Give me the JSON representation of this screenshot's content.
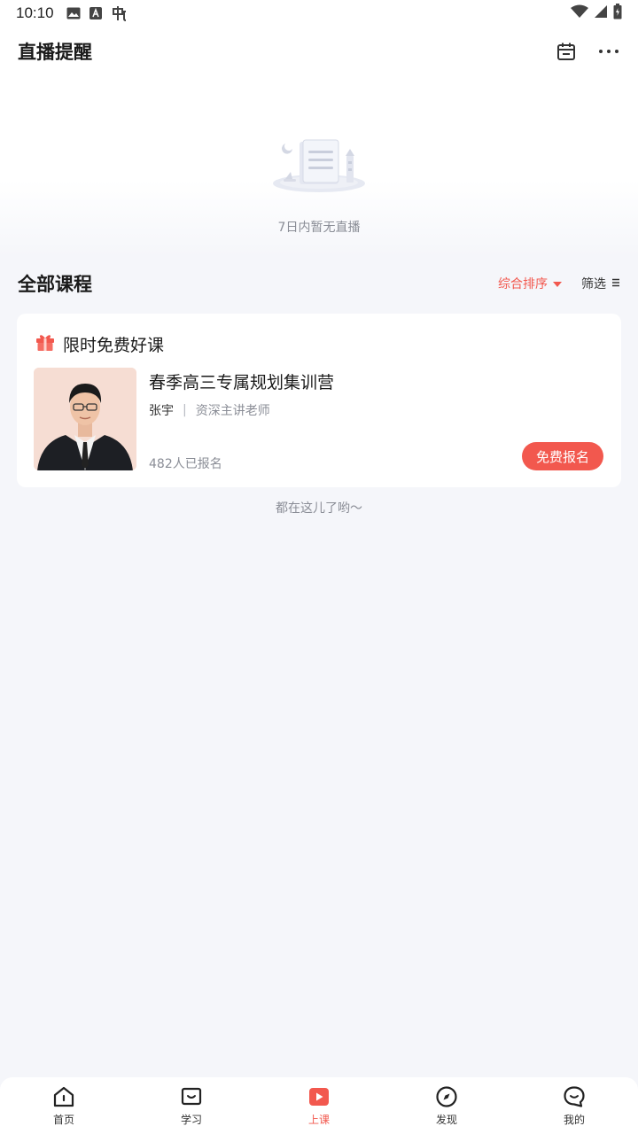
{
  "status_bar": {
    "time": "10:10"
  },
  "header": {
    "title": "直播提醒"
  },
  "empty_live": {
    "text": "7日内暂无直播"
  },
  "section": {
    "title": "全部课程",
    "sort_label": "综合排序",
    "filter_label": "筛选"
  },
  "course_card": {
    "heading": "限时免费好课",
    "course_title": "春季高三专属规划集训营",
    "teacher_name": "张宇",
    "teacher_separator": "|",
    "teacher_role": "资深主讲老师",
    "enrolled_text": "482人已报名",
    "button_label": "免费报名"
  },
  "list_end_text": "都在这儿了哟～",
  "bottom_nav": {
    "items": [
      {
        "label": "首页",
        "icon": "home-icon"
      },
      {
        "label": "学习",
        "icon": "study-icon"
      },
      {
        "label": "上课",
        "icon": "class-play-icon"
      },
      {
        "label": "发现",
        "icon": "compass-icon"
      },
      {
        "label": "我的",
        "icon": "profile-icon"
      }
    ],
    "active": "上课"
  },
  "colors": {
    "accent": "#f2584e",
    "background": "#f5f6fa",
    "text_secondary": "#8a8d96"
  }
}
